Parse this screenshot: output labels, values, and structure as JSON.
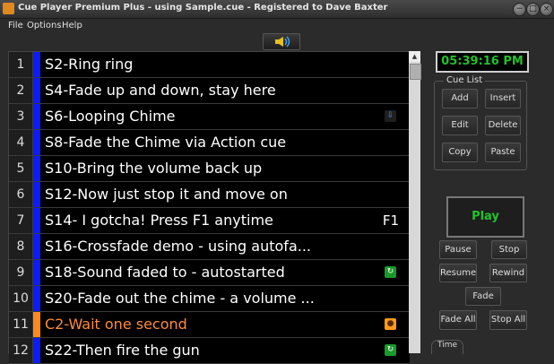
{
  "window": {
    "title": "Cue Player Premium Plus - using Sample.cue - Registered to Dave Baxter",
    "minimize": "−",
    "maximize": "□",
    "close": "×"
  },
  "menu": [
    "File",
    "Options",
    "Help"
  ],
  "clock": "05:39:16 PM",
  "cue_list_group": {
    "label": "Cue List",
    "buttons": [
      "Add",
      "Insert",
      "Edit",
      "Delete",
      "Copy",
      "Paste"
    ]
  },
  "transport": {
    "play": "Play",
    "pause": "Pause",
    "stop": "Stop",
    "resume": "Resume",
    "rewind": "Rewind",
    "fade": "Fade",
    "fade_all": "Fade All",
    "stop_all": "Stop All",
    "time": "Time"
  },
  "cues": [
    {
      "num": "1",
      "name": "S2-Ring ring",
      "color": "#0b1cff",
      "text_color": "#ffffff",
      "hotkey": "",
      "icon": ""
    },
    {
      "num": "2",
      "name": "S4-Fade up and down, stay here",
      "color": "#0b1cff",
      "text_color": "#ffffff",
      "hotkey": "",
      "icon": ""
    },
    {
      "num": "3",
      "name": "S6-Looping Chime",
      "color": "#0b1cff",
      "text_color": "#ffffff",
      "hotkey": "",
      "icon": "loop-down-arrow-icon"
    },
    {
      "num": "4",
      "name": "S8-Fade the Chime via Action cue",
      "color": "#0b1cff",
      "text_color": "#ffffff",
      "hotkey": "",
      "icon": ""
    },
    {
      "num": "5",
      "name": "S10-Bring the volume back up",
      "color": "#0b1cff",
      "text_color": "#ffffff",
      "hotkey": "",
      "icon": ""
    },
    {
      "num": "6",
      "name": "S12-Now just stop it and move on",
      "color": "#0b1cff",
      "text_color": "#ffffff",
      "hotkey": "",
      "icon": ""
    },
    {
      "num": "7",
      "name": "S14- I gotcha! Press F1 anytime",
      "color": "#0b1cff",
      "text_color": "#ffffff",
      "hotkey": "F1",
      "icon": ""
    },
    {
      "num": "8",
      "name": "S16-Crossfade demo  - using autofa...",
      "color": "#0b1cff",
      "text_color": "#ffffff",
      "hotkey": "",
      "icon": ""
    },
    {
      "num": "9",
      "name": "S18-Sound faded to - autostarted",
      "color": "#0b1cff",
      "text_color": "#ffffff",
      "hotkey": "",
      "icon": "autostart-green-icon"
    },
    {
      "num": "10",
      "name": "S20-Fade out the chime - a volume ...",
      "color": "#0b1cff",
      "text_color": "#ffffff",
      "hotkey": "",
      "icon": ""
    },
    {
      "num": "11",
      "name": "C2-Wait one second",
      "color": "#ff8a1c",
      "text_color": "#ff8a3c",
      "hotkey": "",
      "icon": "wait-orange-icon"
    },
    {
      "num": "12",
      "name": "S22-Then fire the gun",
      "color": "#0b1cff",
      "text_color": "#ffffff",
      "hotkey": "",
      "icon": "autostart-green-icon"
    }
  ]
}
